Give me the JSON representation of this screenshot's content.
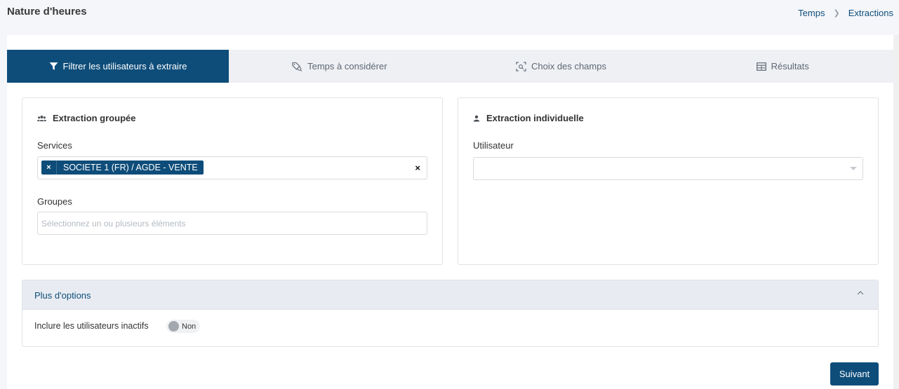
{
  "header": {
    "title": "Nature d'heures",
    "breadcrumb": [
      "Temps",
      "Extractions"
    ]
  },
  "tabs": [
    {
      "label": "Filtrer les utilisateurs à extraire",
      "icon": "filter-icon",
      "active": true
    },
    {
      "label": "Temps à considérer",
      "icon": "tag-search-icon",
      "active": false
    },
    {
      "label": "Choix des champs",
      "icon": "field-search-icon",
      "active": false
    },
    {
      "label": "Résultats",
      "icon": "table-icon",
      "active": false
    }
  ],
  "group_panel": {
    "title": "Extraction groupée",
    "icon": "users-icon",
    "services_label": "Services",
    "services_selected": [
      "SOCIETE 1 (FR) / AGDE - VENTE"
    ],
    "clear_symbol": "×",
    "tag_remove_symbol": "×",
    "groups_label": "Groupes",
    "groups_placeholder": "Sélectionnez un ou plusieurs éléments"
  },
  "individual_panel": {
    "title": "Extraction individuelle",
    "icon": "user-icon",
    "user_label": "Utilisateur",
    "user_value": ""
  },
  "options": {
    "title": "Plus d'options",
    "expanded": true,
    "include_inactive_label": "Inclure les utilisateurs inactifs",
    "include_inactive_value": "Non"
  },
  "footer": {
    "next_label": "Suivant"
  },
  "colors": {
    "primary": "#0e4d7a",
    "tab_bar": "#eef0f4",
    "options_header": "#e8ecf2"
  }
}
